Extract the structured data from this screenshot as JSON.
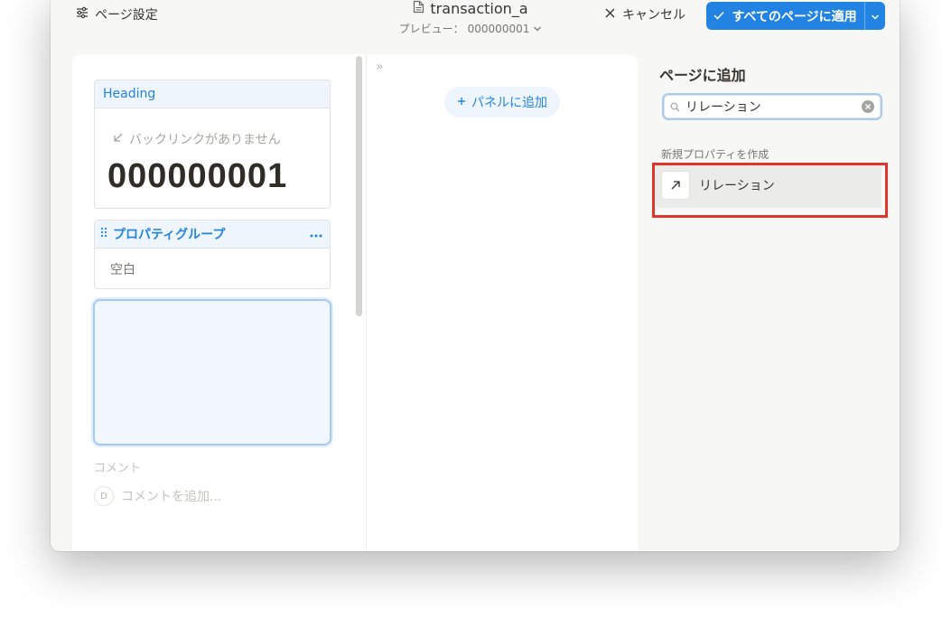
{
  "topbar": {
    "page_settings_label": "ページ設定",
    "title": "transaction_a",
    "preview_label": "プレビュー：",
    "preview_value": "000000001",
    "cancel_label": "キャンセル",
    "apply_label": "すべてのページに適用"
  },
  "left": {
    "heading_label": "Heading",
    "backlink_text": "バックリンクがありません",
    "page_title": "000000001",
    "group_label": "プロパティグループ",
    "group_empty": "空白",
    "comment_label": "コメント",
    "comment_avatar": "D",
    "comment_placeholder": "コメントを追加..."
  },
  "middle": {
    "collapse_icon": "»",
    "add_panel_label": "パネルに追加"
  },
  "right": {
    "title": "ページに追加",
    "search_value": "リレーション",
    "new_property_label": "新規プロパティを作成",
    "result_label": "リレーション"
  },
  "colors": {
    "accent": "#2383e2",
    "highlight": "#e0352b",
    "panel_bg": "#f7f7f5"
  },
  "icons": [
    "sliders-icon",
    "document-icon",
    "chevron-down-icon",
    "close-icon",
    "check-icon",
    "backlink-arrow-icon",
    "drag-handle-icon",
    "more-icon",
    "collapse-icon",
    "plus-icon",
    "search-icon",
    "clear-icon",
    "relation-arrow-icon"
  ]
}
